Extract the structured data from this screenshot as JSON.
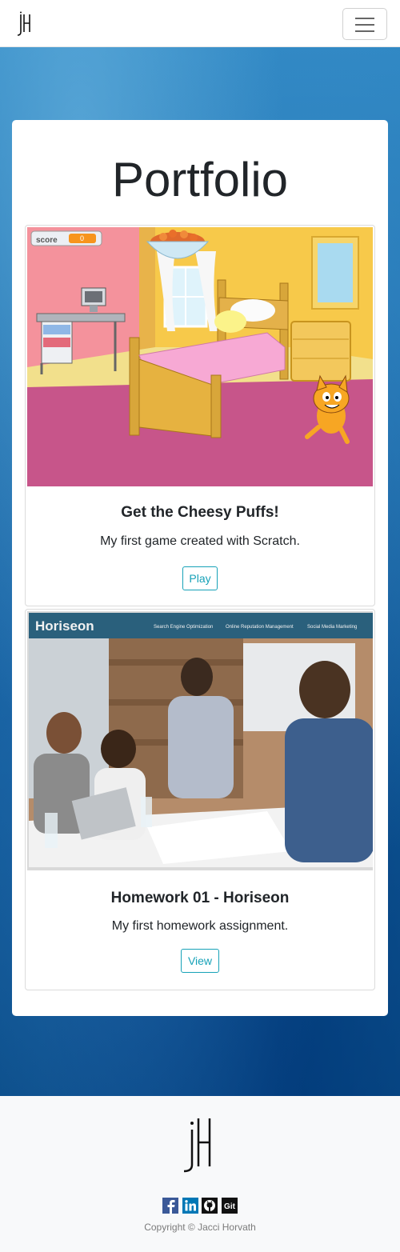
{
  "header": {
    "brand_icon": "jh-monogram-logo",
    "menu_icon": "hamburger-menu-icon"
  },
  "page": {
    "title": "Portfolio"
  },
  "projects": [
    {
      "title": "Get the Cheesy Puffs!",
      "description": "My first game created with Scratch.",
      "button_label": "Play",
      "image": "scratch-bedroom-game-screenshot",
      "score_label": "score",
      "score_value": "0"
    },
    {
      "title": "Homework 01 - Horiseon",
      "description": "My first homework assignment.",
      "button_label": "View",
      "image": "horiseon-website-screenshot",
      "site_brand": "Horiseon",
      "site_nav": [
        "Search Engine Optimization",
        "Online Reputation Management",
        "Social Media Marketing"
      ]
    }
  ],
  "footer": {
    "logo": "jh-monogram-logo",
    "social": [
      {
        "name": "facebook-icon",
        "color": "#3b5998"
      },
      {
        "name": "linkedin-icon",
        "color": "#0077b5"
      },
      {
        "name": "github-icon",
        "color": "#111111"
      },
      {
        "name": "git-icon",
        "color": "#111111"
      }
    ],
    "social_git_text": "Git",
    "copyright": "Copyright © Jacci Horvath"
  }
}
